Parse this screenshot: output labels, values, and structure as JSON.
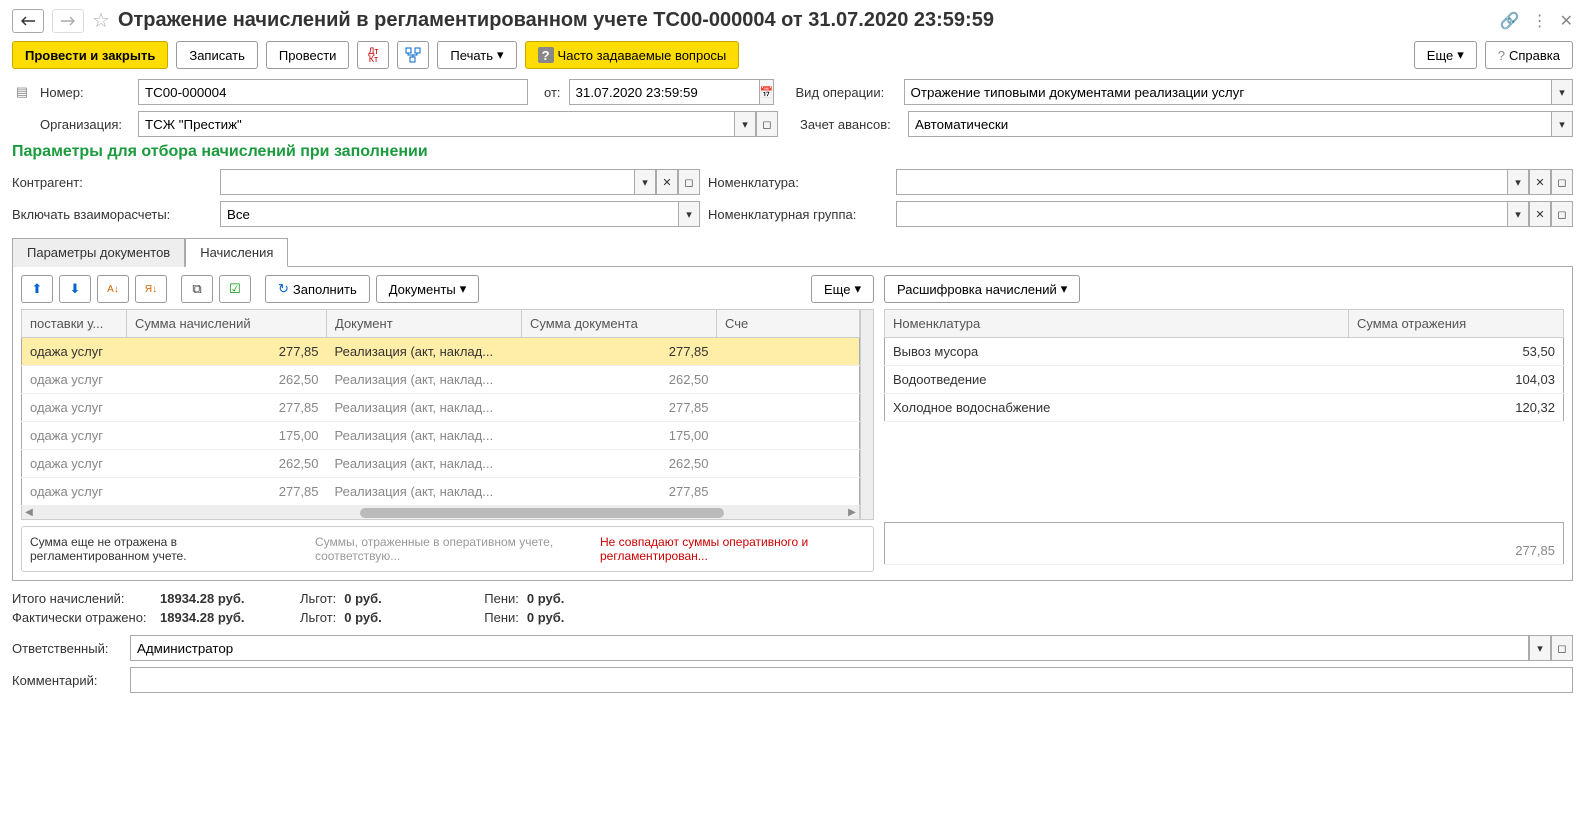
{
  "header": {
    "title": "Отражение начислений в регламентированном учете ТС00-000004 от 31.07.2020 23:59:59"
  },
  "toolbar": {
    "post_close": "Провести и закрыть",
    "save": "Записать",
    "post": "Провести",
    "print": "Печать",
    "faq": "Часто задаваемые вопросы",
    "more": "Еще",
    "help": "Справка"
  },
  "form": {
    "number_label": "Номер:",
    "number": "ТС00-000004",
    "date_label": "от:",
    "date": "31.07.2020 23:59:59",
    "op_type_label": "Вид операции:",
    "op_type": "Отражение типовыми документами реализации услуг",
    "org_label": "Организация:",
    "org": "ТСЖ \"Престиж\"",
    "advance_label": "Зачет авансов:",
    "advance": "Автоматически"
  },
  "filters": {
    "header": "Параметры для отбора начислений при заполнении",
    "counterparty": "Контрагент:",
    "nomenclature": "Номенклатура:",
    "settlements": "Включать взаиморасчеты:",
    "settlements_value": "Все",
    "nomenclature_group": "Номенклатурная группа:"
  },
  "tabs": {
    "params": "Параметры документов",
    "charges": "Начисления"
  },
  "table_toolbar": {
    "fill": "Заполнить",
    "documents": "Документы",
    "more": "Еще",
    "details": "Расшифровка начислений"
  },
  "left_table": {
    "headers": {
      "c1": "поставки у...",
      "c2": "Сумма начислений",
      "c3": "Документ",
      "c4": "Сумма документа",
      "c5": "Сче"
    },
    "rows": [
      {
        "c1": "одажа услуг",
        "c2": "277,85",
        "c3": "Реализация (акт, наклад...",
        "c4": "277,85",
        "selected": true
      },
      {
        "c1": "одажа услуг",
        "c2": "262,50",
        "c3": "Реализация (акт, наклад...",
        "c4": "262,50"
      },
      {
        "c1": "одажа услуг",
        "c2": "277,85",
        "c3": "Реализация (акт, наклад...",
        "c4": "277,85"
      },
      {
        "c1": "одажа услуг",
        "c2": "175,00",
        "c3": "Реализация (акт, наклад...",
        "c4": "175,00"
      },
      {
        "c1": "одажа услуг",
        "c2": "262,50",
        "c3": "Реализация (акт, наклад...",
        "c4": "262,50"
      },
      {
        "c1": "одажа услуг",
        "c2": "277,85",
        "c3": "Реализация (акт, наклад...",
        "c4": "277,85"
      }
    ]
  },
  "right_table": {
    "headers": {
      "c1": "Номенклатура",
      "c2": "Сумма отражения"
    },
    "rows": [
      {
        "c1": "Вывоз мусора",
        "c2": "53,50"
      },
      {
        "c1": "Водоотведение",
        "c2": "104,03"
      },
      {
        "c1": "Холодное водоснабжение",
        "c2": "120,32"
      }
    ],
    "total": "277,85"
  },
  "legend": {
    "l1": "Сумма еще не отражена в регламентированном учете.",
    "l2": "Суммы, отраженные в оперативном учете, соответствую...",
    "l3": "Не совпадают суммы оперативного и регламентирован..."
  },
  "totals": {
    "charges_label": "Итого начислений:",
    "charges_value": "18934.28 руб.",
    "benefits_label": "Льгот:",
    "benefits_value": "0 руб.",
    "penalty_label": "Пени:",
    "penalty_value": "0 руб.",
    "reflected_label": "Фактически отражено:",
    "reflected_value": "18934.28 руб."
  },
  "footer": {
    "responsible_label": "Ответственный:",
    "responsible": "Администратор",
    "comment_label": "Комментарий:"
  }
}
